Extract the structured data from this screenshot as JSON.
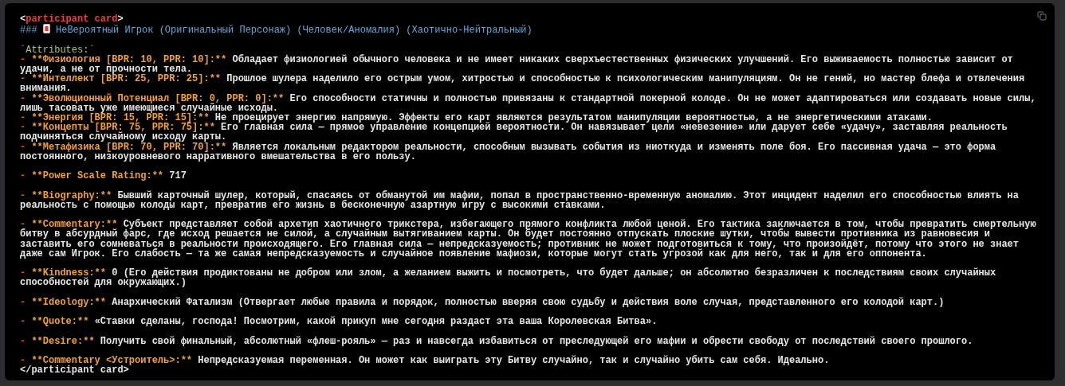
{
  "code_block": {
    "lines": [
      {
        "kind": "tag",
        "open": "<",
        "name": "participant card",
        "close": ">"
      },
      {
        "kind": "heading",
        "prefix": "###",
        "text": "НеВероятный Игрок (Оригинальный Персонаж) (Человек/Аномалия) (Хаотично-Нейтральный)"
      },
      {
        "kind": "blank"
      },
      {
        "kind": "code",
        "text": "`Attributes:`"
      },
      {
        "kind": "item",
        "bullet": "-",
        "label": "**Физиология [BPR: 10, PPR: 10]:**",
        "text": "Обладает физиологией обычного человека и не имеет никаких сверхъестественных физических улучшений. Его выживаемость полностью зависит от удачи, а не от прочности тела."
      },
      {
        "kind": "item",
        "bullet": "-",
        "label": "**Интеллект [BPR: 25, PPR: 25]:**",
        "text": "Прошлое шулера наделило его острым умом, хитростью и способностью к психологическим манипуляциям. Он не гений, но мастер блефа и отвлечения внимания."
      },
      {
        "kind": "item",
        "bullet": "-",
        "label": "**Эволюционный Потенциал [BPR: 0, PPR: 0]:**",
        "text": "Его способности статичны и полностью привязаны к стандартной покерной колоде. Он не может адаптироваться или создавать новые силы, лишь тасовать уже имеющиеся случайные исходы."
      },
      {
        "kind": "item",
        "bullet": "-",
        "label": "**Энергия [BPR: 15, PPR: 15]:**",
        "text": "Не проецирует энергию напрямую. Эффекты его карт являются результатом манипуляции вероятностью, а не энергетическими атаками."
      },
      {
        "kind": "item",
        "bullet": "-",
        "label": "**Концепты [BPR: 75, PPR: 75]:**",
        "text": "Его главная сила — прямое управление концепцией вероятности. Он навязывает цели «невезение» или дарует себе «удачу», заставляя реальность подчиняться случайному исходу карты."
      },
      {
        "kind": "item",
        "bullet": "-",
        "label": "**Метафизика [BPR: 70, PPR: 70]:**",
        "text": "Является локальным редактором реальности, способным вызывать события из ниоткуда и изменять поле боя. Его пассивная удача — это форма постоянного, низкоуровневого нарративного вмешательства в его пользу."
      },
      {
        "kind": "blank"
      },
      {
        "kind": "item",
        "bullet": "-",
        "label": "**Power Scale Rating:**",
        "text": "717"
      },
      {
        "kind": "blank"
      },
      {
        "kind": "item",
        "bullet": "-",
        "label": "**Biography:**",
        "text": "Бывший карточный шулер, который, спасаясь от обманутой им мафии, попал в пространственно-временную аномалию. Этот инцидент наделил его способностью влиять на реальность с помощью колоды карт, превратив его жизнь в бесконечную азартную игру с высокими ставками."
      },
      {
        "kind": "blank"
      },
      {
        "kind": "item",
        "bullet": "-",
        "label": "**Commentary:**",
        "text": "Субъект представляет собой архетип хаотичного трикстера, избегающего прямого конфликта любой ценой. Его тактика заключается в том, чтобы превратить смертельную битву в абсурдный фарс, где исход решается не силой, а случайным вытягиванием карты. Он будет постоянно отпускать плоские шутки, чтобы вывести противника из равновесия и заставить его сомневаться в реальности происходящего. Его главная сила — непредсказуемость; противник не может подготовиться к тому, что произойдёт, потому что этого не знает даже сам Игрок. Его слабость — та же самая непредсказуемость и случайное появление мафиози, которые могут стать угрозой как для него, так и для его оппонента."
      },
      {
        "kind": "blank"
      },
      {
        "kind": "item",
        "bullet": "-",
        "label": "**Kindness:**",
        "text": "0 (Его действия продиктованы не добром или злом, а желанием выжить и посмотреть, что будет дальше; он абсолютно безразличен к последствиям своих случайных способностей для окружающих.)"
      },
      {
        "kind": "blank"
      },
      {
        "kind": "item",
        "bullet": "-",
        "label": "**Ideology:**",
        "text": "Анархический Фатализм (Отвергает любые правила и порядок, полностью вверяя свою судьбу и действия воле случая, представленного его колодой карт.)"
      },
      {
        "kind": "blank"
      },
      {
        "kind": "item",
        "bullet": "-",
        "label": "**Quote:**",
        "text": "«Ставки сделаны, господа! Посмотрим, какой прикуп мне сегодня раздаст эта ваша Королевская Битва»."
      },
      {
        "kind": "blank"
      },
      {
        "kind": "item",
        "bullet": "-",
        "label": "**Desire:**",
        "text": "Получить свой финальный, абсолютный «флеш-рояль» — раз и навсегда избавиться от преследующей его мафии и обрести свободу от последствий своего прошлого."
      },
      {
        "kind": "blank"
      },
      {
        "kind": "item",
        "bullet": "-",
        "label": "**Commentary <Устроитель>:**",
        "text": "Непредсказуемая переменная. Он может как выиграть эту Битву случайно, так и случайно убить сам себя. Идеально."
      },
      {
        "kind": "plain",
        "text": "</participant card>"
      }
    ]
  }
}
